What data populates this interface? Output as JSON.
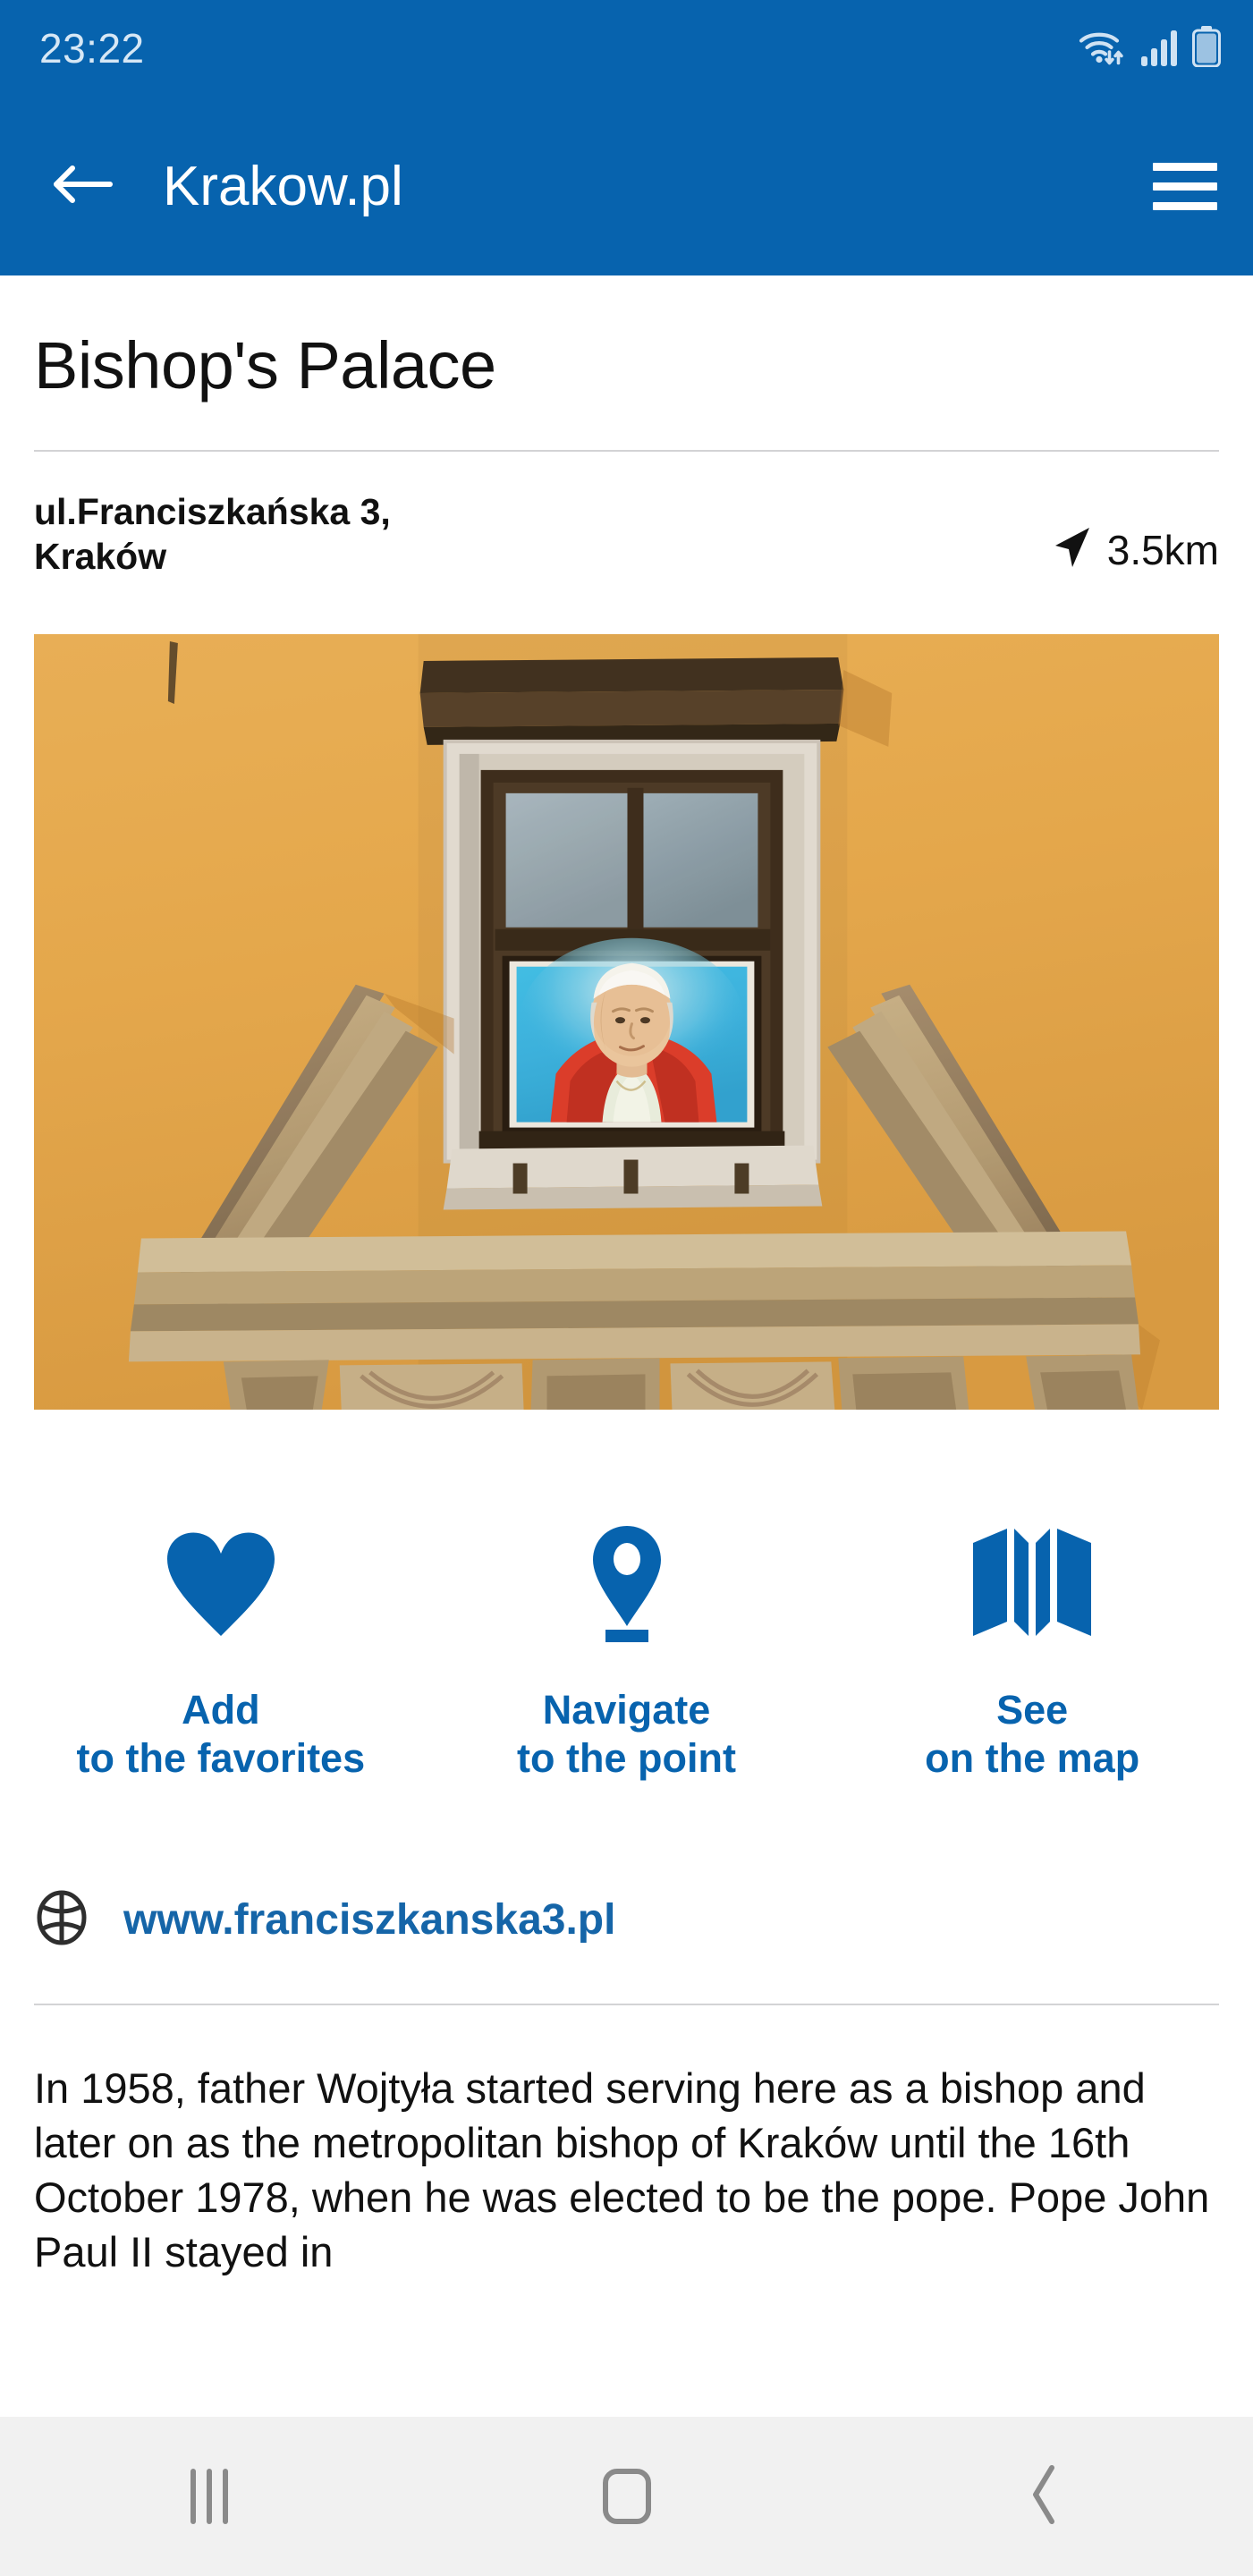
{
  "statusbar": {
    "time": "23:22",
    "icons": [
      "wifi-icon",
      "cellular-signal-icon",
      "battery-icon"
    ]
  },
  "appbar": {
    "back_icon": "arrow-left-icon",
    "title": "Krakow.pl",
    "menu_icon": "hamburger-menu-icon"
  },
  "poi": {
    "name": "Bishop's Palace",
    "address_line1": "ul.Franciszkańska 3,",
    "address_line2": "Kraków",
    "distance": "3.5km",
    "distance_icon": "navigation-arrow-icon",
    "photo_alt": "Window of the Bishop's Palace with portrait of Pope John Paul II"
  },
  "actions": [
    {
      "icon": "heart-icon",
      "label": "Add\nto the favorites"
    },
    {
      "icon": "map-pin-icon",
      "label": "Navigate\nto the point"
    },
    {
      "icon": "folded-map-icon",
      "label": "See\non the map"
    }
  ],
  "website": {
    "icon": "globe-icon",
    "url": "www.franciszkanska3.pl"
  },
  "description": "In 1958, father Wojtyła started serving here as a bishop and later on as the metropolitan bishop of Kraków until the 16th October 1978, when he was elected to be the pope. Pope John Paul II stayed in",
  "navbar": {
    "recents_icon": "recents-icon",
    "home_icon": "home-icon",
    "back_icon": "back-chevron-icon"
  },
  "colors": {
    "brand_blue": "#0763ae",
    "link_blue": "#1565a8",
    "status_text": "#d6e7f5",
    "navbar_bg": "#f1f1f1"
  }
}
